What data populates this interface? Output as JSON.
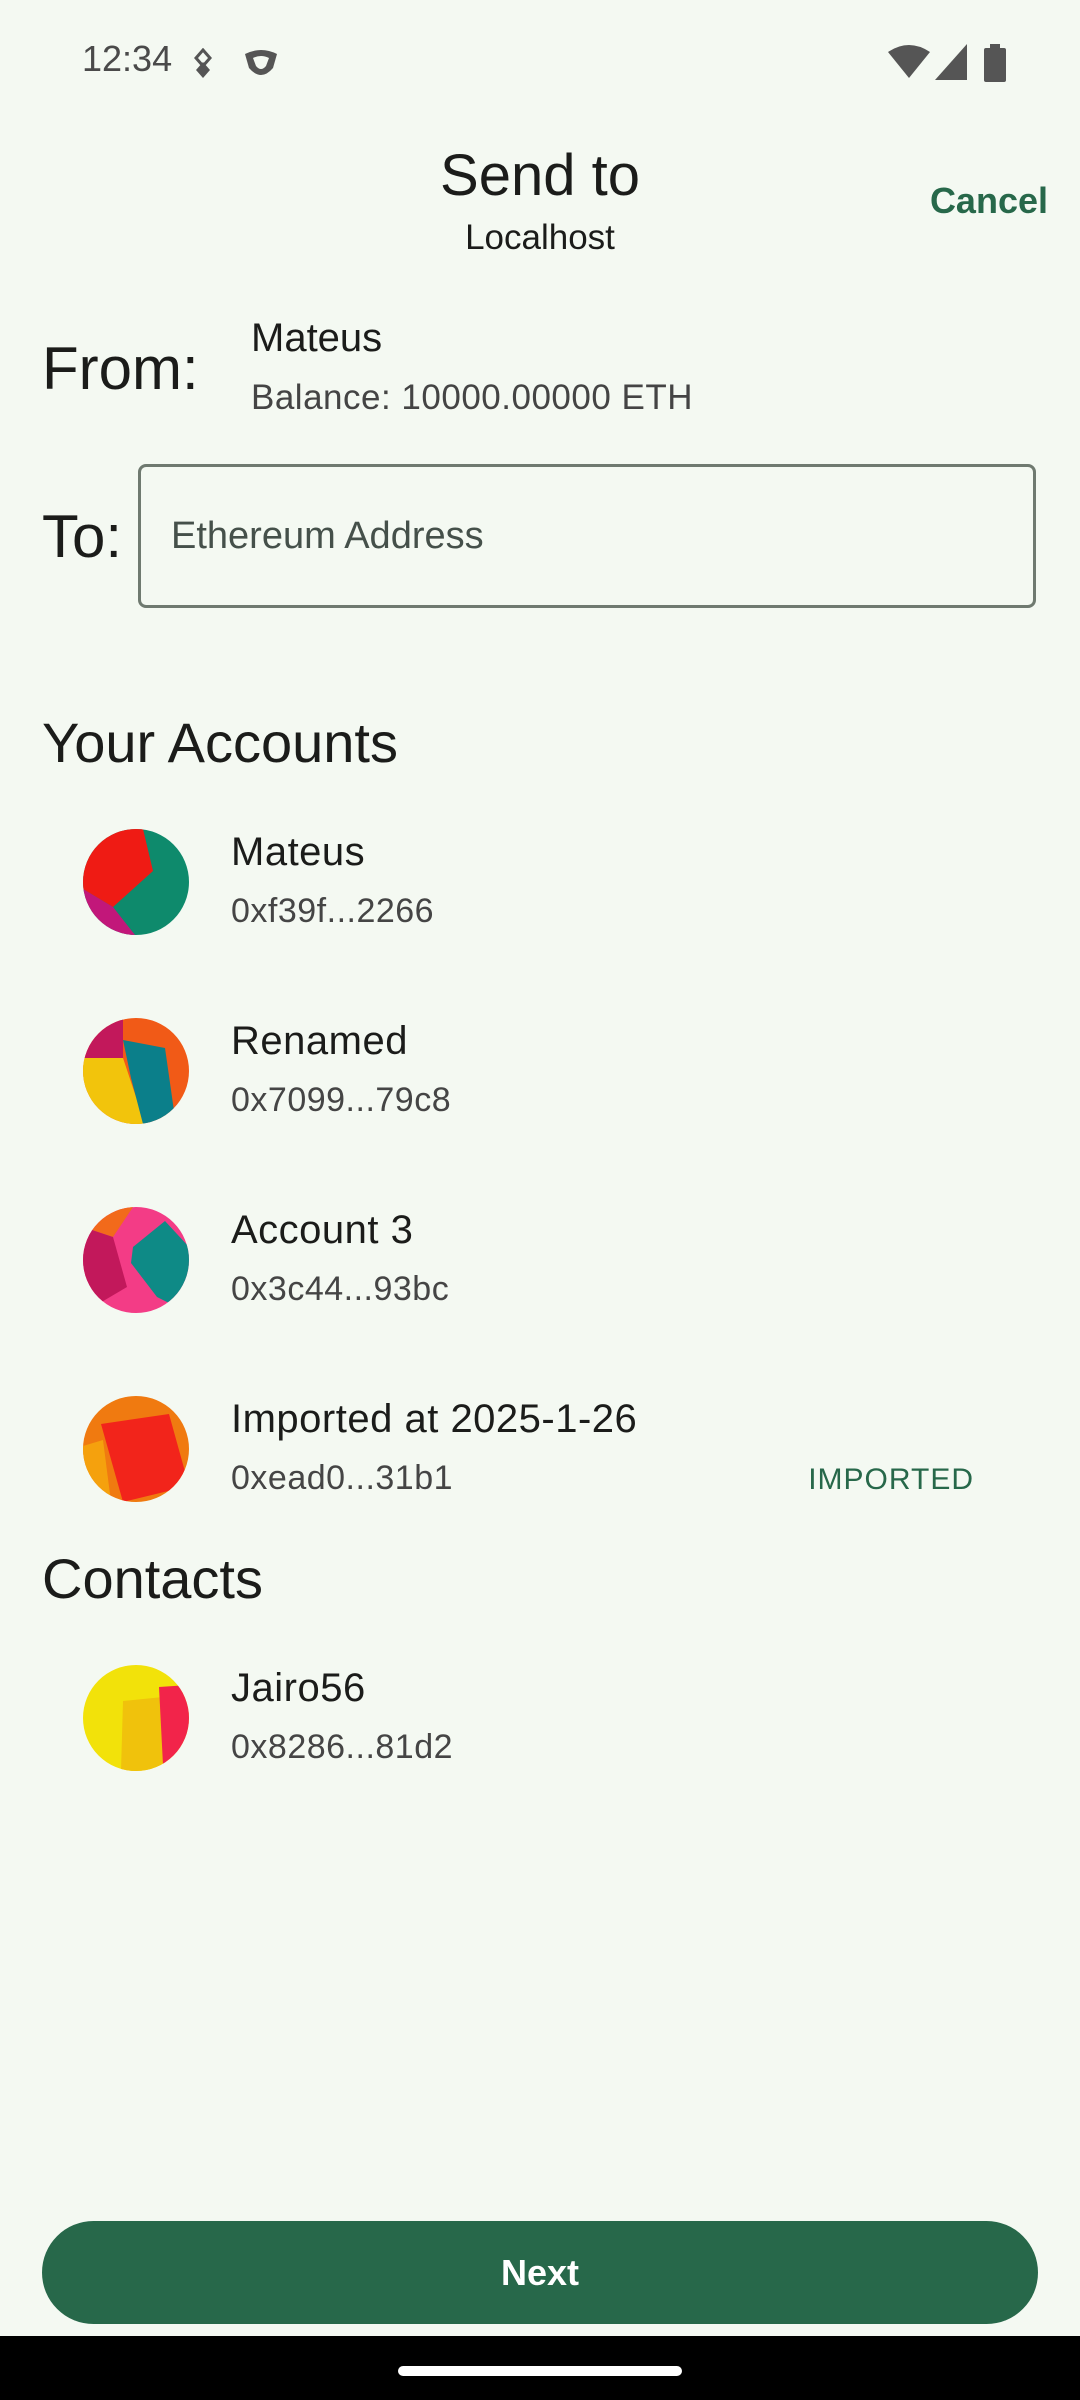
{
  "status_bar": {
    "time": "12:34"
  },
  "header": {
    "title": "Send to",
    "subtitle": "Localhost",
    "cancel_label": "Cancel"
  },
  "from": {
    "label": "From:",
    "name": "Mateus",
    "balance": "Balance: 10000.00000 ETH"
  },
  "to": {
    "label": "To:",
    "placeholder": "Ethereum Address",
    "value": ""
  },
  "accounts_section": {
    "title": "Your Accounts",
    "items": [
      {
        "name": "Mateus",
        "address": "0xf39f...2266",
        "tag": ""
      },
      {
        "name": "Renamed",
        "address": "0x7099...79c8",
        "tag": ""
      },
      {
        "name": "Account 3",
        "address": "0x3c44...93bc",
        "tag": ""
      },
      {
        "name": "Imported at 2025-1-26",
        "address": "0xead0...31b1",
        "tag": "IMPORTED"
      }
    ]
  },
  "contacts_section": {
    "title": "Contacts",
    "items": [
      {
        "name": "Jairo56",
        "address": "0x8286...81d2"
      }
    ]
  },
  "next_label": "Next",
  "colors": {
    "accent": "#27684a",
    "background": "#f4f9f2"
  }
}
